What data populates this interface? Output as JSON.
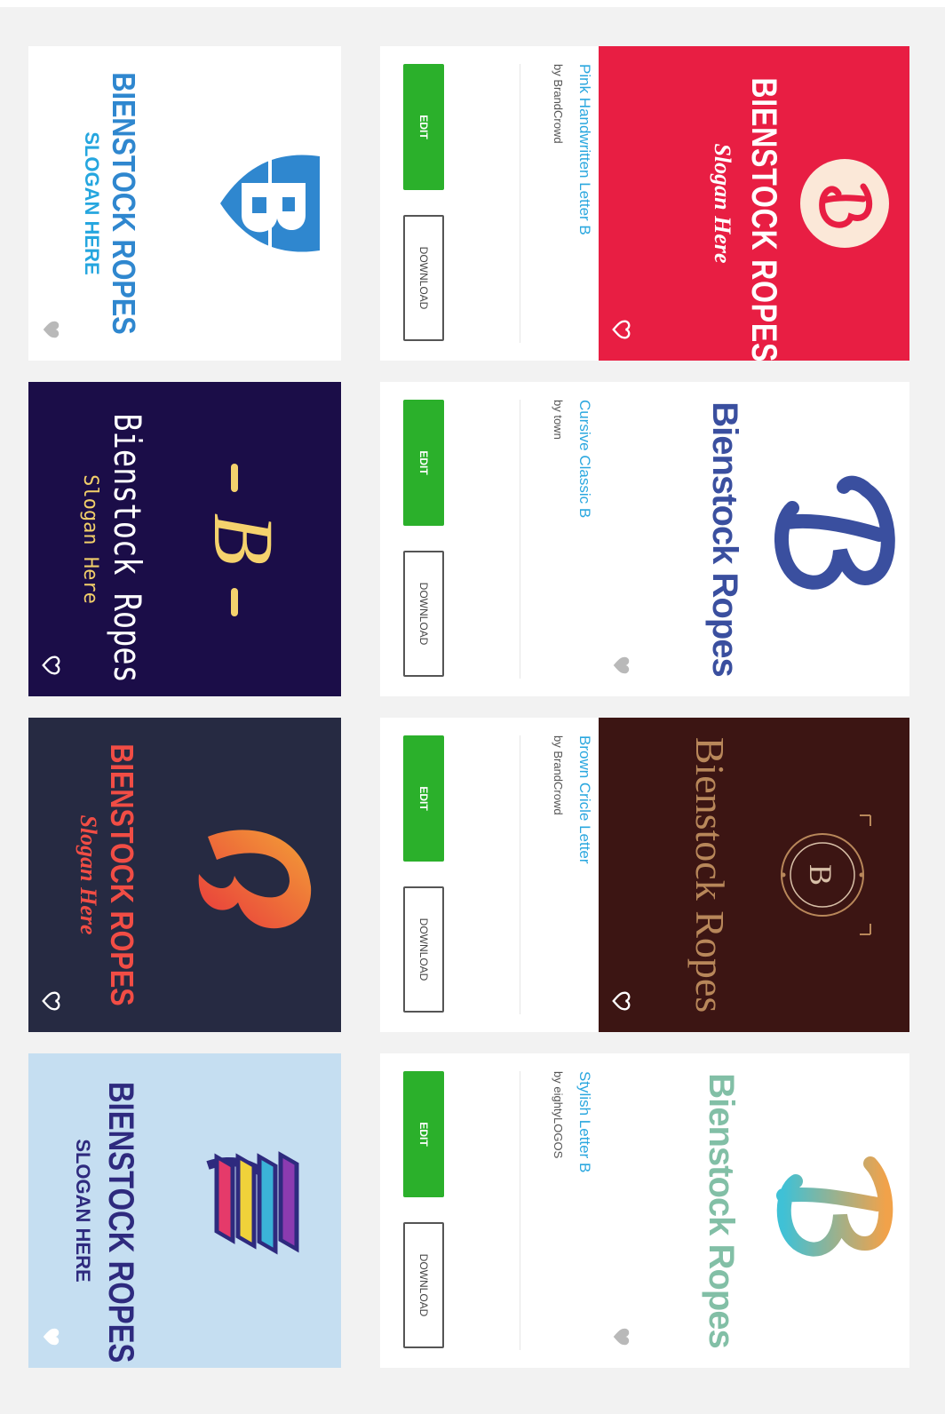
{
  "right_column": [
    {
      "name": "Pink Handwritten Letter B",
      "author": "by BrandCrowd",
      "edit_label": "EDIT",
      "download_label": "DOWNLOAD",
      "logo": {
        "brand": "BIENSTOCK ROPES",
        "slogan": "Slogan Here",
        "letter": "B",
        "bg": "#e81e43",
        "fg": "#ffffff",
        "accent": "#fbe8d8",
        "heart_color": "#ffffff",
        "heart_icon": "heart-outline-icon"
      }
    },
    {
      "name": "Cursive Classic B",
      "author": "by town",
      "edit_label": "EDIT",
      "download_label": "DOWNLOAD",
      "logo": {
        "brand": "Bienstock Ropes",
        "letter": "B",
        "bg": "#ffffff",
        "fg": "#3a4f9f",
        "heart_color": "#b9b9b9",
        "heart_icon": "heart-filled-icon"
      }
    },
    {
      "name": "Brown Cricle Letter",
      "author": "by BrandCrowd",
      "edit_label": "EDIT",
      "download_label": "DOWNLOAD",
      "logo": {
        "brand": "Bienstock Ropes",
        "letter": "B",
        "bg": "#3c1513",
        "fg": "#b8875a",
        "heart_color": "#ffffff",
        "heart_icon": "heart-outline-icon"
      }
    },
    {
      "name": "Stylish Letter B",
      "author": "by eightyLOGOS",
      "edit_label": "EDIT",
      "download_label": "DOWNLOAD",
      "logo": {
        "brand": "Bienstock Ropes",
        "letter": "B",
        "bg": "#ffffff",
        "fg": "#82bfa6",
        "heart_color": "#b9b9b9",
        "heart_icon": "heart-filled-icon"
      }
    }
  ],
  "left_column": [
    {
      "brand": "BIENSTOCK ROPES",
      "slogan": "SLOGAN HERE",
      "letter": "B",
      "bg": "#ffffff",
      "fg": "#2f87cf",
      "slogan_color": "#25a6df",
      "heart_color": "#b9b9b9",
      "heart_icon": "heart-filled-icon"
    },
    {
      "brand": "Bienstock Ropes",
      "slogan": "Slogan Here",
      "letter": "B",
      "bg": "#1b0d48",
      "fg": "#f5d26d",
      "slogan_color": "#f2cf6a",
      "brand_color": "#ffffff",
      "heart_color": "#ffffff",
      "heart_icon": "heart-outline-icon"
    },
    {
      "brand": "BIENSTOCK ROPES",
      "slogan": "Slogan Here",
      "letter": "B",
      "bg": "#262a42",
      "fg": "#f07a2b",
      "slogan_color": "#f14d45",
      "brand_color": "#f14d45",
      "heart_color": "#ffffff",
      "heart_icon": "heart-outline-icon"
    },
    {
      "brand": "BIENSTOCK ROPES",
      "slogan": "SLOGAN HERE",
      "bg": "#c5def1",
      "fg": "#2e2a7e",
      "slogan_color": "#2e2a7e",
      "heart_color": "#ffffff",
      "heart_icon": "heart-filled-icon"
    }
  ]
}
